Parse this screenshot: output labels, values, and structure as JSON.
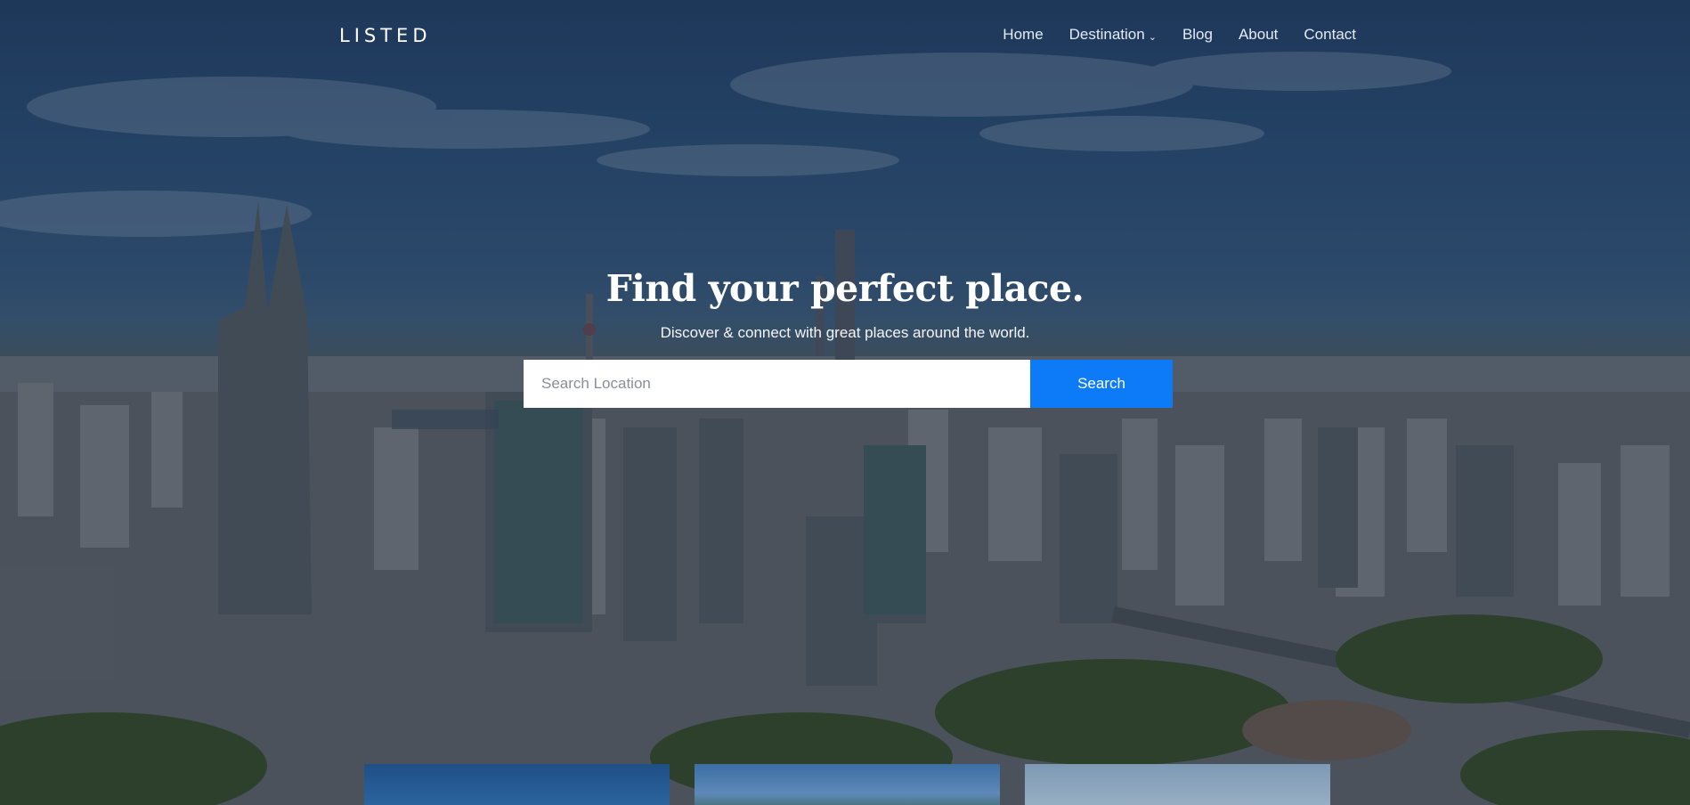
{
  "brand": {
    "logo": "LISTED"
  },
  "nav": {
    "items": [
      {
        "label": "Home"
      },
      {
        "label": "Destination",
        "has_dropdown": true
      },
      {
        "label": "Blog"
      },
      {
        "label": "About"
      },
      {
        "label": "Contact"
      }
    ],
    "dropdown_icon": "chevron-down-icon"
  },
  "hero": {
    "title": "Find your perfect place.",
    "subtitle": "Discover & connect with great places around the world.",
    "search": {
      "placeholder": "Search Location",
      "value": "",
      "button_label": "Search"
    },
    "background": "city skyline aerial photo"
  },
  "colors": {
    "accent": "#0d7bf7",
    "nav_text": "#e4ebf5",
    "heading": "#ffffff"
  },
  "cards": [
    {
      "image": "blue sky thumbnail"
    },
    {
      "image": "sky and hills thumbnail"
    },
    {
      "image": "pale sky thumbnail"
    }
  ]
}
